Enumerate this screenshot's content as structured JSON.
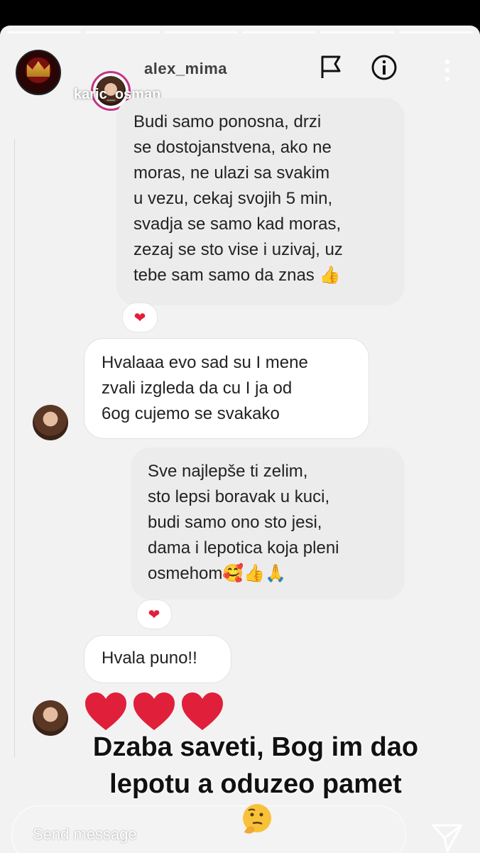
{
  "story": {
    "username": "karic_osman",
    "progress_segments": 6
  },
  "dm_header": {
    "name": "alex_mima",
    "icons": [
      "flag-icon",
      "info-icon",
      "more-icon"
    ]
  },
  "messages": [
    {
      "direction": "outgoing",
      "text": "Budi samo ponosna, drzi\nse dostojanstvena, ako ne\nmoras, ne ulazi sa svakim\nu vezu, cekaj svojih 5 min,\nsvadja se samo kad moras,\nzezaj se sto vise i uzivaj, uz\ntebe sam samo da znas 👍",
      "reaction": "❤"
    },
    {
      "direction": "incoming",
      "text": "Hvalaaa evo sad su I mene\nzvali izgleda da cu I ja od\n6og cujemo se svakako"
    },
    {
      "direction": "outgoing",
      "text": "Sve najlepše ti zelim,\nsto lepsi boravak u kuci,\nbudi   samo ono sto jesi,\ndama i lepotica koja pleni\nosmehom🥰👍🙏",
      "reaction": "❤"
    },
    {
      "direction": "incoming",
      "text": "Hvala puno!!"
    }
  ],
  "hearts_count": 3,
  "caption": {
    "line1": "Dzaba saveti, Bog im dao",
    "line2": "lepotu a oduzeo pamet",
    "emoji": "thinking-face-icon"
  },
  "reply": {
    "placeholder": "Send message"
  },
  "colors": {
    "heart": "#e0203a",
    "outgoing_bubble": "#ececec",
    "incoming_bubble": "#ffffff",
    "story_ring": "#c13584"
  }
}
